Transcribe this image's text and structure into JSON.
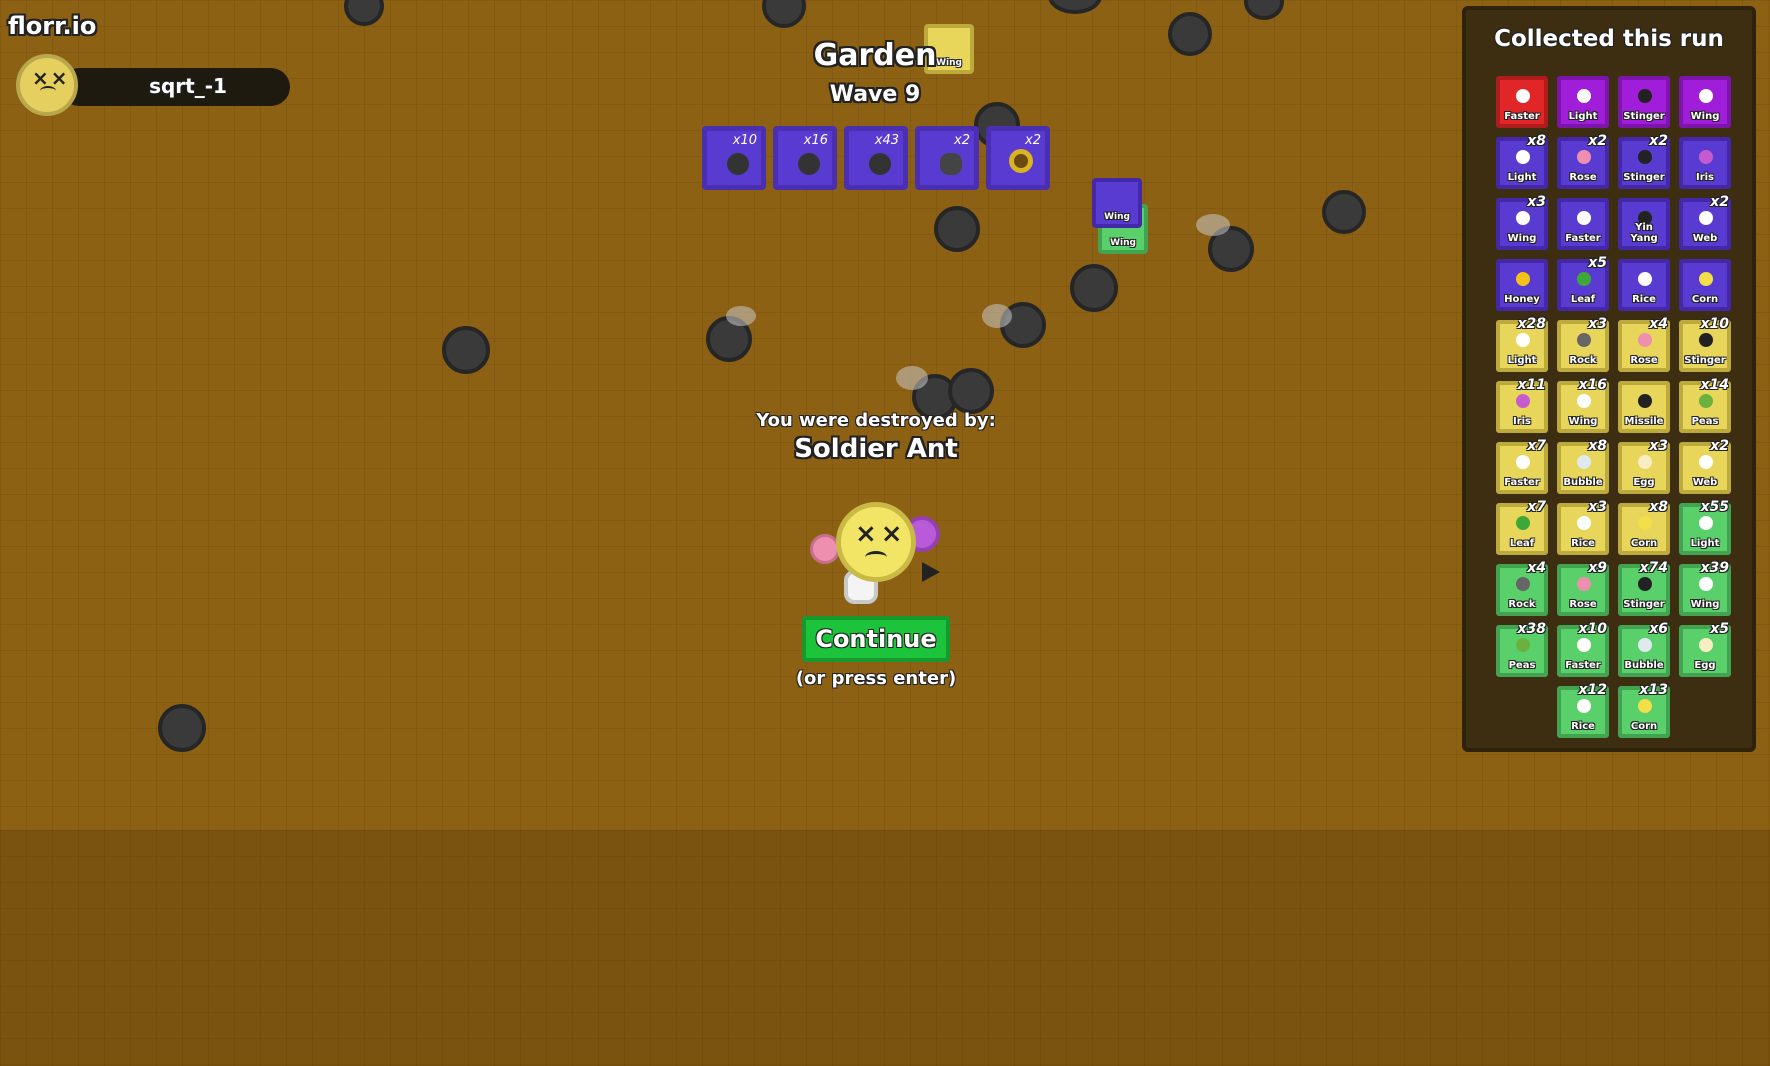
{
  "game": {
    "logo": "florr.io",
    "player_name": "sqrt_-1",
    "zone": "Garden",
    "wave": "Wave 9"
  },
  "drops_bar": [
    {
      "count": "x10",
      "icon": "ant-icon"
    },
    {
      "count": "x16",
      "icon": "ant-icon"
    },
    {
      "count": "x43",
      "icon": "ant-icon"
    },
    {
      "count": "x2",
      "icon": "fly-icon"
    },
    {
      "count": "x2",
      "icon": "sunflower-icon"
    }
  ],
  "ground_items": [
    {
      "label": "Wing",
      "rarity": "rare"
    },
    {
      "label": "Wing",
      "rarity": "epic"
    },
    {
      "label": "Wing",
      "rarity": "unusual"
    }
  ],
  "death": {
    "destroyed_label": "You were destroyed by:",
    "killer": "Soldier Ant",
    "continue_label": "Continue",
    "press_enter": "(or press enter)"
  },
  "panel": {
    "title": "Collected this run",
    "petals": [
      {
        "name": "Faster",
        "count": "",
        "rarity": "mythic"
      },
      {
        "name": "Light",
        "count": "",
        "rarity": "legendary"
      },
      {
        "name": "Stinger",
        "count": "",
        "rarity": "legendary"
      },
      {
        "name": "Wing",
        "count": "",
        "rarity": "legendary"
      },
      {
        "name": "Light",
        "count": "x8",
        "rarity": "epic"
      },
      {
        "name": "Rose",
        "count": "x2",
        "rarity": "epic"
      },
      {
        "name": "Stinger",
        "count": "x2",
        "rarity": "epic"
      },
      {
        "name": "Iris",
        "count": "",
        "rarity": "epic"
      },
      {
        "name": "Wing",
        "count": "x3",
        "rarity": "epic"
      },
      {
        "name": "Faster",
        "count": "",
        "rarity": "epic"
      },
      {
        "name": "Yin Yang",
        "count": "",
        "rarity": "epic"
      },
      {
        "name": "Web",
        "count": "x2",
        "rarity": "epic"
      },
      {
        "name": "Honey",
        "count": "",
        "rarity": "epic"
      },
      {
        "name": "Leaf",
        "count": "x5",
        "rarity": "epic"
      },
      {
        "name": "Rice",
        "count": "",
        "rarity": "epic"
      },
      {
        "name": "Corn",
        "count": "",
        "rarity": "epic"
      },
      {
        "name": "Light",
        "count": "x28",
        "rarity": "rare"
      },
      {
        "name": "Rock",
        "count": "x3",
        "rarity": "rare"
      },
      {
        "name": "Rose",
        "count": "x4",
        "rarity": "rare"
      },
      {
        "name": "Stinger",
        "count": "x10",
        "rarity": "rare"
      },
      {
        "name": "Iris",
        "count": "x11",
        "rarity": "rare"
      },
      {
        "name": "Wing",
        "count": "x16",
        "rarity": "rare"
      },
      {
        "name": "Missile",
        "count": "",
        "rarity": "rare"
      },
      {
        "name": "Peas",
        "count": "x14",
        "rarity": "rare"
      },
      {
        "name": "Faster",
        "count": "x7",
        "rarity": "rare"
      },
      {
        "name": "Bubble",
        "count": "x8",
        "rarity": "rare"
      },
      {
        "name": "Egg",
        "count": "x3",
        "rarity": "rare"
      },
      {
        "name": "Web",
        "count": "x2",
        "rarity": "rare"
      },
      {
        "name": "Leaf",
        "count": "x7",
        "rarity": "rare"
      },
      {
        "name": "Rice",
        "count": "x3",
        "rarity": "rare"
      },
      {
        "name": "Corn",
        "count": "x8",
        "rarity": "rare"
      },
      {
        "name": "Light",
        "count": "x55",
        "rarity": "unusual"
      },
      {
        "name": "Rock",
        "count": "x4",
        "rarity": "unusual"
      },
      {
        "name": "Rose",
        "count": "x9",
        "rarity": "unusual"
      },
      {
        "name": "Stinger",
        "count": "x74",
        "rarity": "unusual"
      },
      {
        "name": "Wing",
        "count": "x39",
        "rarity": "unusual"
      },
      {
        "name": "Peas",
        "count": "x38",
        "rarity": "unusual"
      },
      {
        "name": "Faster",
        "count": "x10",
        "rarity": "unusual"
      },
      {
        "name": "Bubble",
        "count": "x6",
        "rarity": "unusual"
      },
      {
        "name": "Egg",
        "count": "x5",
        "rarity": "unusual"
      },
      {
        "name": "Rice",
        "count": "x12",
        "rarity": "unusual"
      },
      {
        "name": "Corn",
        "count": "x13",
        "rarity": "unusual"
      }
    ]
  },
  "colors": {
    "ground": "#8d6113",
    "mythic": "#e02626",
    "legendary": "#a01dd9",
    "epic": "#5a3bd1",
    "rare": "#e8d65b",
    "unusual": "#5ad06a",
    "continue": "#1bc43a"
  }
}
